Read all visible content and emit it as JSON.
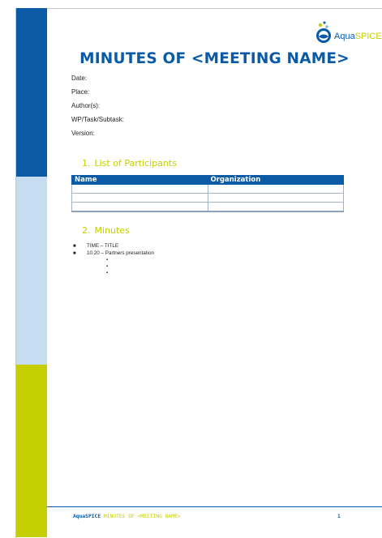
{
  "logo": {
    "text_primary": "Aqua",
    "text_highlight": "SPICE"
  },
  "title": "MINUTES OF <MEETING NAME>",
  "meta_fields": [
    "Date:",
    "Place:",
    "Author(s):",
    "WP/Task/Subtask:",
    "Version:"
  ],
  "section1": {
    "number": "1.",
    "heading": "List of Participants"
  },
  "participants_table": {
    "headers": [
      "Name",
      "Organization"
    ],
    "rows": [
      [
        "",
        ""
      ],
      [
        "",
        ""
      ],
      [
        "",
        ""
      ]
    ]
  },
  "section2": {
    "number": "2.",
    "heading": "Minutes"
  },
  "minutes": {
    "items": [
      "TIME – TITLE",
      "10.20 – Partners presentation"
    ],
    "sub_items": [
      "",
      "",
      ""
    ]
  },
  "footer": {
    "brand": "AquaSPICE",
    "doc": "MINUTES OF <MEETING NAME>",
    "page": "1"
  },
  "colors": {
    "blue": "#0b5aa5",
    "light_blue": "#c6dcf1",
    "green": "#c5ce00"
  }
}
